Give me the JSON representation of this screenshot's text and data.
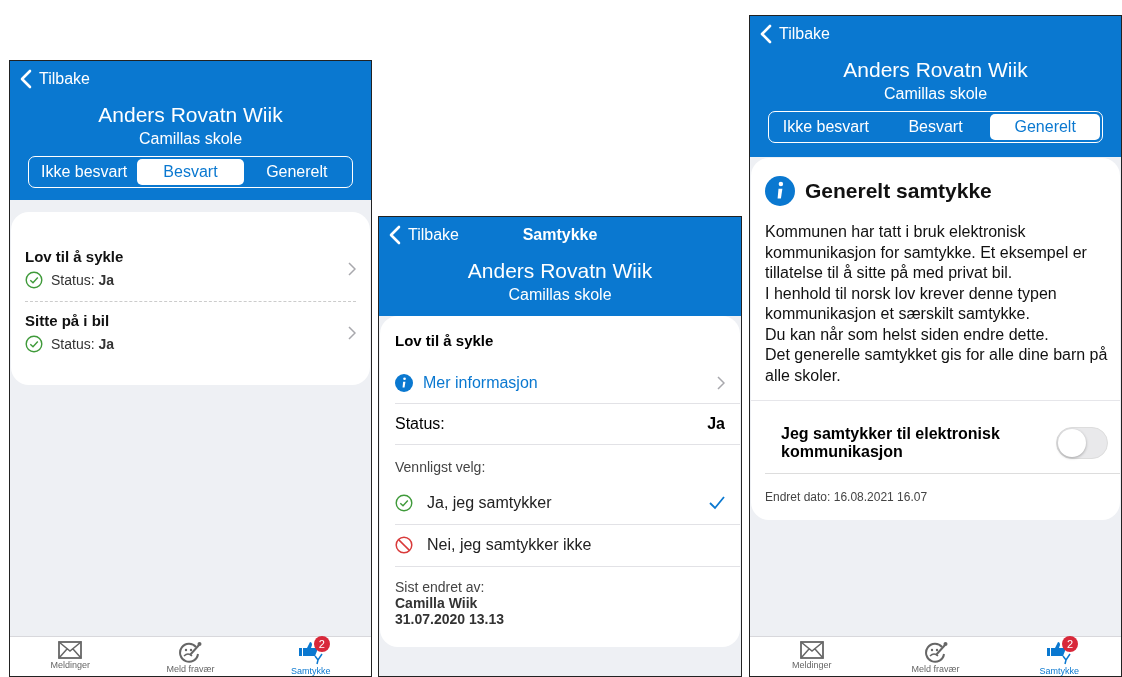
{
  "screens": [
    {
      "kind": "list",
      "back": "Tilbake",
      "name": "Anders Rovatn Wiik",
      "school": "Camillas skole",
      "segments": [
        {
          "label": "Ikke besvart",
          "selected": false
        },
        {
          "label": "Besvart",
          "selected": true
        },
        {
          "label": "Generelt",
          "selected": false
        }
      ],
      "items": [
        {
          "title": "Lov til å sykle",
          "status": "Status: **Ja**",
          "answered": true
        },
        {
          "title": "Sitte på i bil",
          "status": "Status: **Ja**",
          "answered": true
        }
      ],
      "tabbar": [
        {
          "kind": "messages",
          "label": "Meldinger",
          "selected": false
        },
        {
          "kind": "absence",
          "label": "Meld fravær",
          "selected": false
        },
        {
          "kind": "consent",
          "label": "Samtykke",
          "selected": true,
          "badge": "2"
        }
      ]
    },
    {
      "kind": "detail",
      "back": "Tilbake",
      "title": "Samtykke",
      "name": "Anders Rovatn Wiik",
      "school": "Camillas skole",
      "card": {
        "heading": "Lov til å sykle",
        "info_link": "Mer informasjon",
        "status_label": "Status:",
        "status_value": "Ja",
        "prompt": "Vennligst velg:",
        "options": [
          {
            "kind": "yes",
            "label": "Ja, jeg samtykker",
            "selected": true
          },
          {
            "kind": "no",
            "label": "Nei, jeg samtykker ikke",
            "selected": false
          }
        ],
        "changed_by_label": "Sist endret av:",
        "changed_by_name": "Camilla Wiik",
        "changed_date": "31.07.2020 13.13"
      }
    },
    {
      "kind": "general",
      "back": "Tilbake",
      "name": "Anders Rovatn Wiik",
      "school": "Camillas skole",
      "segments": [
        {
          "label": "Ikke besvart",
          "selected": false
        },
        {
          "label": "Besvart",
          "selected": false
        },
        {
          "label": "Generelt",
          "selected": true
        }
      ],
      "card": {
        "heading": "Generelt samtykke",
        "paragraphs": [
          "Kommunen har tatt i bruk elektronisk kommunikasjon for samtykke. Et eksempel er tillatelse til å sitte på med privat bil.",
          "I henhold til norsk lov krever denne typen kommunikasjon et særskilt samtykke.",
          "Du kan når som helst siden endre dette.",
          "Det generelle samtykket gis for alle dine barn på alle skoler."
        ],
        "toggle": {
          "label": "Jeg samtykker til elektronisk kommunikasjon",
          "on": false
        },
        "changed_date": "Endret dato: 16.08.2021 16.07"
      },
      "tabbar": [
        {
          "kind": "messages",
          "label": "Meldinger",
          "selected": false
        },
        {
          "kind": "absence",
          "label": "Meld fravær",
          "selected": false
        },
        {
          "kind": "consent",
          "label": "Samtykke",
          "selected": true,
          "badge": "2"
        }
      ]
    }
  ]
}
